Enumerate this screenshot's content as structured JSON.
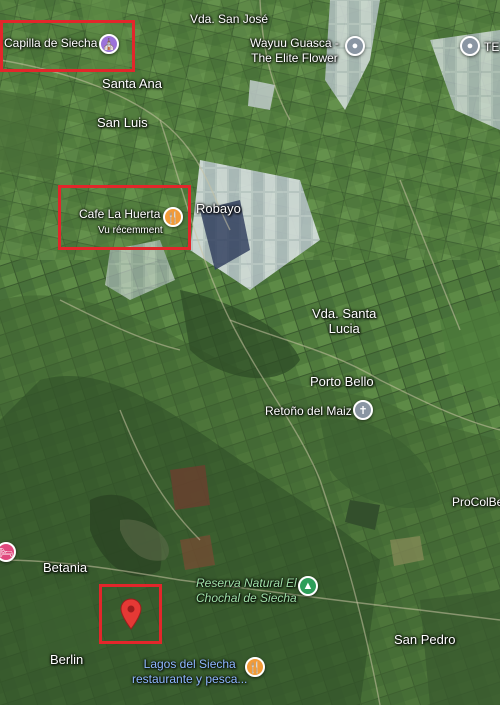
{
  "places": {
    "vda_san_jose": "Vda. San José",
    "capilla": "Capilla de Siecha",
    "santa_ana": "Santa Ana",
    "san_luis": "San Luis",
    "wayuu_line1": "Wayuu Guasca -",
    "wayuu_line2": "The Elite Flower",
    "te_label": "TE",
    "cafe": "Cafe La Huerta",
    "cafe_sub": "Vu récemment",
    "robayo": "Robayo",
    "vda_santa_lucia_1": "Vda. Santa",
    "vda_santa_lucia_2": "Lucia",
    "porto_bello": "Porto Bello",
    "retono": "Retoño del Maiz",
    "procolbe": "ProColBe",
    "betania": "Betania",
    "berlin": "Berlin",
    "reserva_1": "Reserva Natural El",
    "reserva_2": "Chochal de Siecha",
    "san_pedro": "San Pedro",
    "lagos_1": "Lagos del Siecha",
    "lagos_2": "restaurante y pesca..."
  },
  "icons": {
    "capilla": "place-of-worship-icon",
    "cafe": "restaurant-icon",
    "wayuu": "location-pin-icon",
    "te": "location-pin-icon",
    "retono": "cemetery-icon",
    "reserva": "park-icon",
    "lagos": "restaurant-icon",
    "hotel": "hotel-icon",
    "selected": "red-location-marker-icon"
  },
  "colors": {
    "highlight": "#e3262b",
    "food_pin": "#f29b38",
    "worship_pin": "#9b72d9",
    "park_pin": "#2e9e5a",
    "gray_pin": "#8a96a3",
    "hotel_pin": "#e0497e",
    "marker": "#e53935"
  }
}
